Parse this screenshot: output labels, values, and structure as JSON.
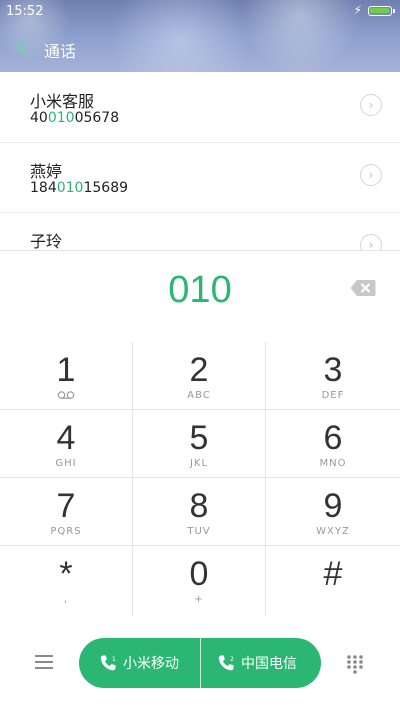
{
  "status_bar": {
    "time": "15:52",
    "battery_percent": 100
  },
  "title_bar": {
    "title": "通话"
  },
  "suggestions": [
    {
      "name": "小米客服",
      "number_pre": "40",
      "number_match": "010",
      "number_post": "05678"
    },
    {
      "name": "燕婷",
      "number_pre": "184",
      "number_match": "010",
      "number_post": "15689"
    },
    {
      "name": "子玲",
      "number_pre": "",
      "number_match": "",
      "number_post": ""
    }
  ],
  "input": {
    "digits": "010"
  },
  "keypad": {
    "k1": {
      "main": "1",
      "sub": ""
    },
    "k2": {
      "main": "2",
      "sub": "ABC"
    },
    "k3": {
      "main": "3",
      "sub": "DEF"
    },
    "k4": {
      "main": "4",
      "sub": "GHI"
    },
    "k5": {
      "main": "5",
      "sub": "JKL"
    },
    "k6": {
      "main": "6",
      "sub": "MNO"
    },
    "k7": {
      "main": "7",
      "sub": "PQRS"
    },
    "k8": {
      "main": "8",
      "sub": "TUV"
    },
    "k9": {
      "main": "9",
      "sub": "WXYZ"
    },
    "kstar": {
      "main": "*",
      "sub": ","
    },
    "k0": {
      "main": "0",
      "sub": "+"
    },
    "khash": {
      "main": "#",
      "sub": ""
    }
  },
  "call_buttons": {
    "sim1_label": "小米移动",
    "sim2_label": "中国电信"
  },
  "colors": {
    "accent": "#2bb673"
  },
  "icons": [
    "back-arrow-icon",
    "lightning-icon",
    "battery-icon",
    "chevron-right-icon",
    "backspace-icon",
    "voicemail-icon",
    "menu-icon",
    "phone-sim1-icon",
    "phone-sim2-icon",
    "dialpad-icon"
  ]
}
